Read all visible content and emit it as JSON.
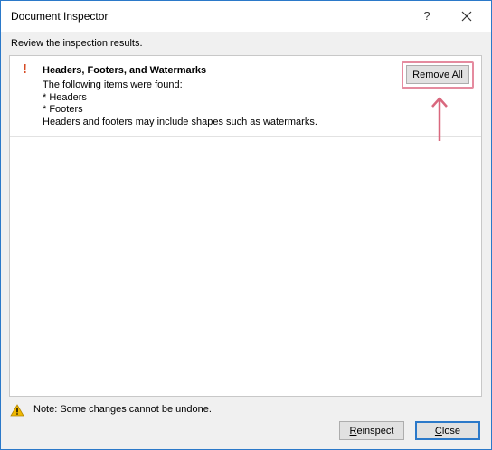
{
  "window": {
    "title": "Document Inspector",
    "help_label": "?",
    "accent_color": "#2b79c9"
  },
  "subtitle": "Review the inspection results.",
  "results": [
    {
      "status_icon": "exclamation-icon",
      "status_symbol": "!",
      "title": "Headers, Footers, and Watermarks",
      "lines": [
        "The following items were found:",
        "* Headers",
        "* Footers",
        "Headers and footers may include shapes such as watermarks."
      ],
      "action_label": "Remove All"
    }
  ],
  "annotation": {
    "highlight_color": "#e58b9f",
    "arrow_color": "#d9687e"
  },
  "note": {
    "icon": "warning-icon",
    "text": "Note: Some changes cannot be undone."
  },
  "buttons": {
    "reinspect": {
      "mnemonic": "R",
      "rest": "einspect"
    },
    "close": {
      "mnemonic": "C",
      "rest": "lose"
    }
  }
}
